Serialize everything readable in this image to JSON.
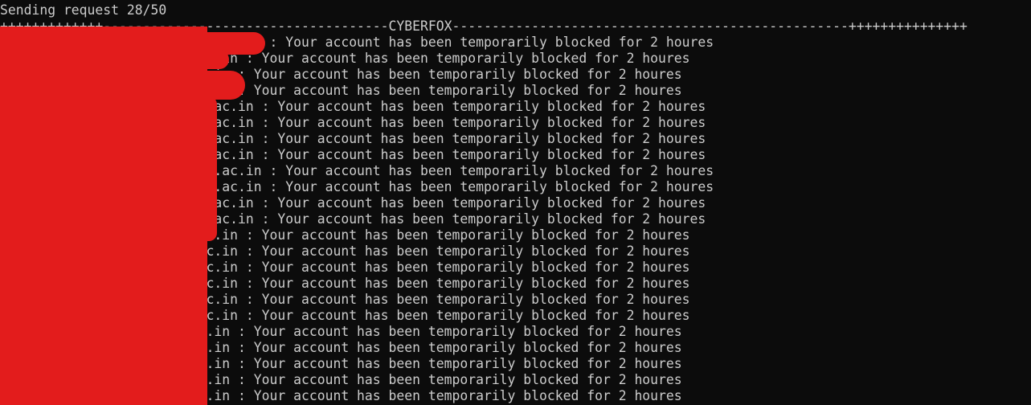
{
  "terminal": {
    "cut_line": "   ── ──  ──          ──  ── ── ───           ──  ──",
    "status": "Sending request 28/50",
    "banner": "+++++++++++++------------------------------------CYBERFOX--------------------------------------------------+++++++++++++++",
    "lines_a": [
      "                                  : Your account has been temporarily blocked for 2 houres",
      "                          c.in : Your account has been temporarily blocked for 2 houres",
      "                           in : Your account has been temporarily blocked for 2 houres",
      "                           in : Your account has been temporarily blocked for 2 houres",
      "                          .ac.in : Your account has been temporarily blocked for 2 houres",
      "                          .ac.in : Your account has been temporarily blocked for 2 houres",
      "                          .ac.in : Your account has been temporarily blocked for 2 houres",
      "                          .ac.in : Your account has been temporarily blocked for 2 houres",
      "                          e.ac.in : Your account has been temporarily blocked for 2 houres",
      "                          e.ac.in : Your account has been temporarily blocked for 2 houres",
      "                          .ac.in : Your account has been temporarily blocked for 2 houres",
      "                          .ac.in : Your account has been temporarily blocked for 2 houres"
    ],
    "lines_b": [
      "                          c.in : Your account has been temporarily blocked for 2 houres",
      "                          c.in : Your account has been temporarily blocked for 2 houres",
      "                          c.in : Your account has been temporarily blocked for 2 houres",
      "                          c.in : Your account has been temporarily blocked for 2 houres",
      "                          c.in : Your account has been temporarily blocked for 2 houres",
      "                          c.in : Your account has been temporarily blocked for 2 houres",
      "                          .in : Your account has been temporarily blocked for 2 houres",
      "                          .in : Your account has been temporarily blocked for 2 houres",
      "                          .in : Your account has been temporarily blocked for 2 houres",
      "                          .in : Your account has been temporarily blocked for 2 houres",
      "                          .in : Your account has been temporarily blocked for 2 houres"
    ]
  },
  "colors": {
    "background": "#0c0c0c",
    "text": "#cccccc",
    "redaction": "#e31c1c"
  }
}
